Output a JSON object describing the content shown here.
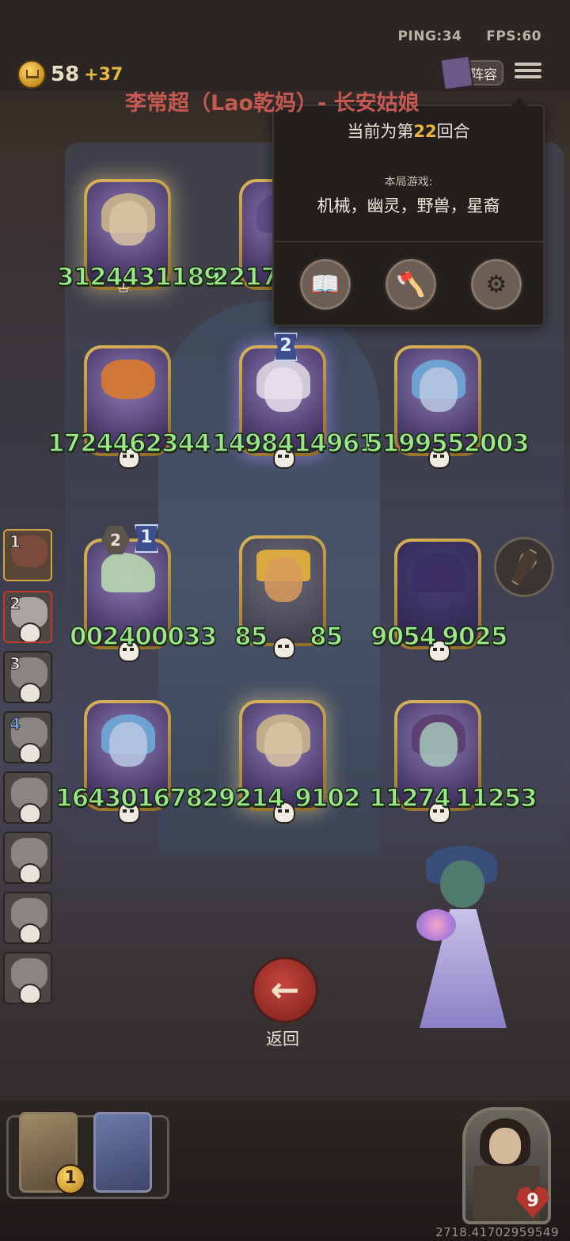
{
  "header": {
    "ping": "PING:34",
    "fps": "FPS:60",
    "gold": "58",
    "gold_income": "+37",
    "lineup_label": "阵容",
    "streamer_overlay": "李常超（Lao乾妈）- 长安姑娘"
  },
  "popup": {
    "round_prefix": "当前为第",
    "round_number": "22",
    "round_suffix": "回合",
    "tribes_label": "本局游戏:",
    "tribes": "机械，幽灵，野兽，星裔",
    "buttons": [
      {
        "icon": "book-icon"
      },
      {
        "icon": "axe-icon"
      },
      {
        "icon": "gear-icon"
      }
    ]
  },
  "board": {
    "cards": [
      {
        "attack": "31244",
        "health": "31189"
      },
      {
        "attack": "2217",
        "health": ""
      },
      {
        "attack": "17244",
        "health": "62344"
      },
      {
        "attack": "14984",
        "health": "14961"
      },
      {
        "attack": "51995",
        "health": "52003"
      },
      {
        "attack": "00240",
        "health": "0033"
      },
      {
        "attack": "85",
        "health": "85"
      },
      {
        "attack": "9054",
        "health": "9025"
      },
      {
        "attack": "16430",
        "health": "16782"
      },
      {
        "attack": "9214",
        "health": "9102"
      },
      {
        "attack": "11274",
        "health": "11253"
      }
    ],
    "badges": {
      "card_level_a": "2",
      "card_level_b": "1",
      "hex_tier": "2"
    }
  },
  "sidebar": {
    "slots": [
      {
        "num": "1"
      },
      {
        "num": "2"
      },
      {
        "num": "3"
      },
      {
        "num": "4"
      },
      {
        "num": ""
      },
      {
        "num": ""
      },
      {
        "num": ""
      },
      {
        "num": ""
      }
    ]
  },
  "back_button": {
    "label": "返回"
  },
  "player": {
    "hand_count": "1",
    "health": "9"
  },
  "footer": {
    "code": "2718.41702959549"
  }
}
